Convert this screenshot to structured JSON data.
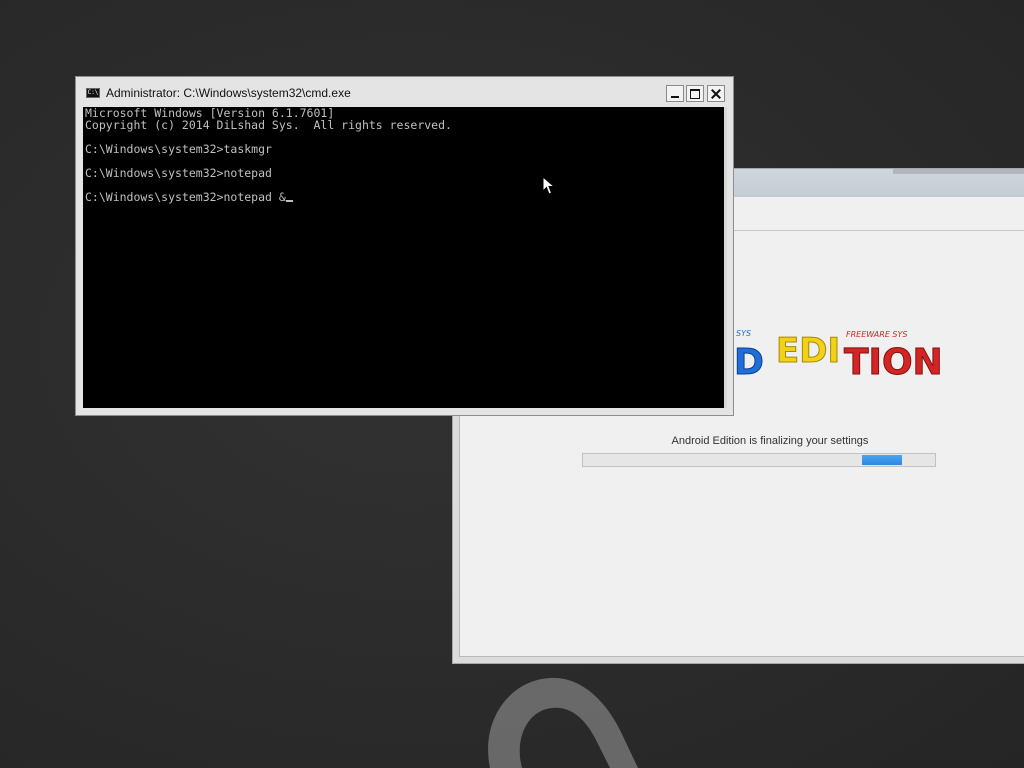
{
  "cmd": {
    "title": "Administrator: C:\\Windows\\system32\\cmd.exe",
    "lines": [
      "Microsoft Windows [Version 6.1.7601]",
      "Copyright (c) 2014 DiLshad Sys.  All rights reserved.",
      "",
      "C:\\Windows\\system32>taskmgr",
      "",
      "C:\\Windows\\system32>notepad",
      "",
      "C:\\Windows\\system32>notepad &"
    ]
  },
  "setup": {
    "logo": {
      "left_tag": "SYS",
      "right_tag": "FREEWARE SYS",
      "word_part1": "D",
      "word_part2": "EDI",
      "word_part3": "TION"
    },
    "status_text": "Android Edition is finalizing your settings",
    "progress": {
      "mode": "marquee",
      "chunk_position_fraction": 0.8
    }
  },
  "colors": {
    "console_bg": "#000000",
    "console_text": "#c0c0c0",
    "progress_accent": "#3a92e8",
    "logo_blue": "#1e6fd9",
    "logo_yellow": "#f2d11a",
    "logo_red": "#d42525"
  },
  "icons": [
    "cmd-icon",
    "minimize-icon",
    "maximize-icon",
    "close-icon",
    "mouse-pointer-icon"
  ]
}
